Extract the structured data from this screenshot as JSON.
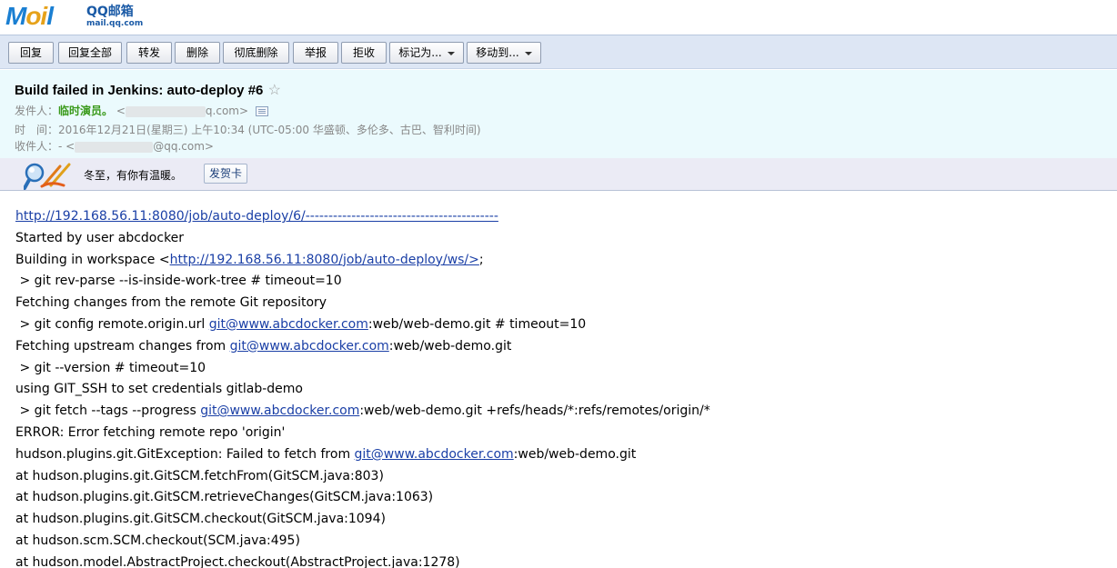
{
  "logo": {
    "brand_m": "M",
    "brand_oi": "oi",
    "brand_l": "l",
    "cn": "QQ邮箱",
    "url": "mail.qq.com"
  },
  "toolbar": {
    "reply": "回复",
    "reply_all": "回复全部",
    "forward": "转发",
    "delete": "删除",
    "delete_permanent": "彻底删除",
    "report": "举报",
    "reject": "拒收",
    "mark_as": "标记为...",
    "move_to": "移动到..."
  },
  "message": {
    "subject": "Build failed in Jenkins: auto-deploy #6",
    "star": "☆",
    "from_label": "发件人：",
    "from_name": "临时演员。",
    "from_open": "<",
    "from_domain": "q.com>",
    "time_label": "时　间：",
    "time_value": "2016年12月21日(星期三) 上午10:34 (UTC-05:00 华盛顿、多伦多、古巴、智利时间)",
    "to_label": "收件人：",
    "to_prefix": "- <",
    "to_domain": "@qq.com>"
  },
  "greeting": {
    "text": "冬至，有你有温暖。",
    "button": "发贺卡"
  },
  "body": {
    "l1_link": "http://192.168.56.11:8080/job/auto-deploy/6/------------------------------------------",
    "l2": "Started by user abcdocker",
    "l3_pre": "Building in workspace <",
    "l3_link": "http://192.168.56.11:8080/job/auto-deploy/ws/>",
    "l3_post": ";",
    "l4": " > git rev-parse --is-inside-work-tree # timeout=10",
    "l5": "Fetching changes from the remote Git repository",
    "l6_pre": " > git config remote.origin.url ",
    "l6_link": "git@www.abcdocker.com",
    "l6_post": ":web/web-demo.git # timeout=10",
    "l7_pre": "Fetching upstream changes from ",
    "l7_link": "git@www.abcdocker.com",
    "l7_post": ":web/web-demo.git",
    "l8": " > git --version # timeout=10",
    "l9": "using GIT_SSH to set credentials gitlab-demo",
    "l10_pre": " > git fetch --tags --progress ",
    "l10_link": "git@www.abcdocker.com",
    "l10_post": ":web/web-demo.git +refs/heads/*:refs/remotes/origin/*",
    "l11": "ERROR: Error fetching remote repo 'origin'",
    "l12_pre": "hudson.plugins.git.GitException: Failed to fetch from ",
    "l12_link": "git@www.abcdocker.com",
    "l12_post": ":web/web-demo.git",
    "l13": "at hudson.plugins.git.GitSCM.fetchFrom(GitSCM.java:803)",
    "l14": "at hudson.plugins.git.GitSCM.retrieveChanges(GitSCM.java:1063)",
    "l15": "at hudson.plugins.git.GitSCM.checkout(GitSCM.java:1094)",
    "l16": "at hudson.scm.SCM.checkout(SCM.java:495)",
    "l17": "at hudson.model.AbstractProject.checkout(AbstractProject.java:1278)"
  }
}
